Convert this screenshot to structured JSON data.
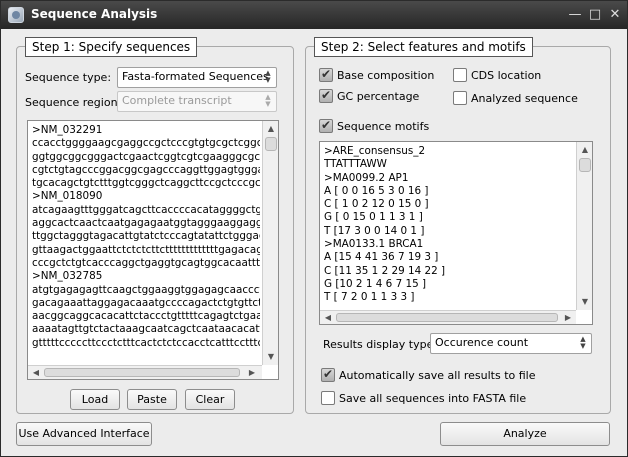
{
  "window": {
    "title": "Sequence Analysis"
  },
  "titlebar_controls": {
    "minimize": "—",
    "maximize": "□",
    "close": "✕"
  },
  "step1": {
    "title": "Step 1: Specify sequences",
    "sequence_type_label": "Sequence type:",
    "sequence_type_value": "Fasta-formated Sequences",
    "sequence_region_label": "Sequence region:",
    "sequence_region_value": "Complete transcript",
    "sequence_lines": [
      ">NM_032291",
      "ccacctggggaagcgaggccgctcccgtgtgcgctcggcggg",
      "ggtggcggcgggactcgaactcggtcgtcgaagggcgcccc",
      "cgtctgtagcccggacggcgagcccaggttggagtgggagg",
      "tgcacagctgtctttggtcgggctcaggcttccgctcccgcctg",
      ">NM_018090",
      "atcagaagtttgggatcagcttcaccccacataggggctggc",
      "aggcactcaactcaatgagagaatggtagggaaggaggga",
      "ttggctagggtagacattgtatctcccagtatattctgggaga",
      "gttaagactggaattctctctcttctttttttttttttgagacaga",
      "cccgctctgtcacccaggctgaggtgcagtggcacaatttcag",
      ">NM_032785",
      "atgtgagagagttcaagctggaaggtggagagcaaccctca",
      "gacagaaattaggagacaaatgccccagactctgtgttcttca",
      "aacggcaggcacacattctaccctgtttttcagagtctgaagc",
      "aaaatagttgtctactaaagcaatcagctcaataacacatttt",
      "gtttttcccccttccctctttcactctctccacctcatttcctttcag"
    ],
    "load_button": "Load",
    "paste_button": "Paste",
    "clear_button": "Clear"
  },
  "step2": {
    "title": "Step 2: Select features and motifs",
    "options": {
      "base_composition": {
        "label": "Base composition",
        "checked": true
      },
      "gc_percentage": {
        "label": "GC percentage",
        "checked": true
      },
      "cds_location": {
        "label": "CDS location",
        "checked": false
      },
      "analyzed_sequence": {
        "label": "Analyzed sequence",
        "checked": false
      },
      "sequence_motifs": {
        "label": "Sequence motifs",
        "checked": true
      }
    },
    "motif_lines": [
      ">ARE_consensus_2",
      "TTATTTAWW",
      ">MA0099.2 AP1",
      "A  [ 0  0 16  5  3  0 16 ]",
      "C  [ 1  0  2 12  0 15  0 ]",
      "G  [ 0 15  0  1  1  3  1 ]",
      "T  [17  3  0  0 14  0  1 ]",
      ">MA0133.1 BRCA1",
      "A  [15  4 41 36  7 19  3 ]",
      "C  [11 35  1  2 29 14 22 ]",
      "G  [10  2  1  4  6  7 15 ]",
      "T  [ 7  2  0  1  1  3  3 ]"
    ],
    "results_display_label": "Results display type:",
    "results_display_value": "Occurence count",
    "auto_save": {
      "label": "Automatically save all results to file",
      "checked": true
    },
    "save_fasta": {
      "label": "Save all sequences into FASTA file",
      "checked": false
    }
  },
  "footer": {
    "advanced_button": "Use Advanced Interface",
    "analyze_button": "Analyze"
  }
}
